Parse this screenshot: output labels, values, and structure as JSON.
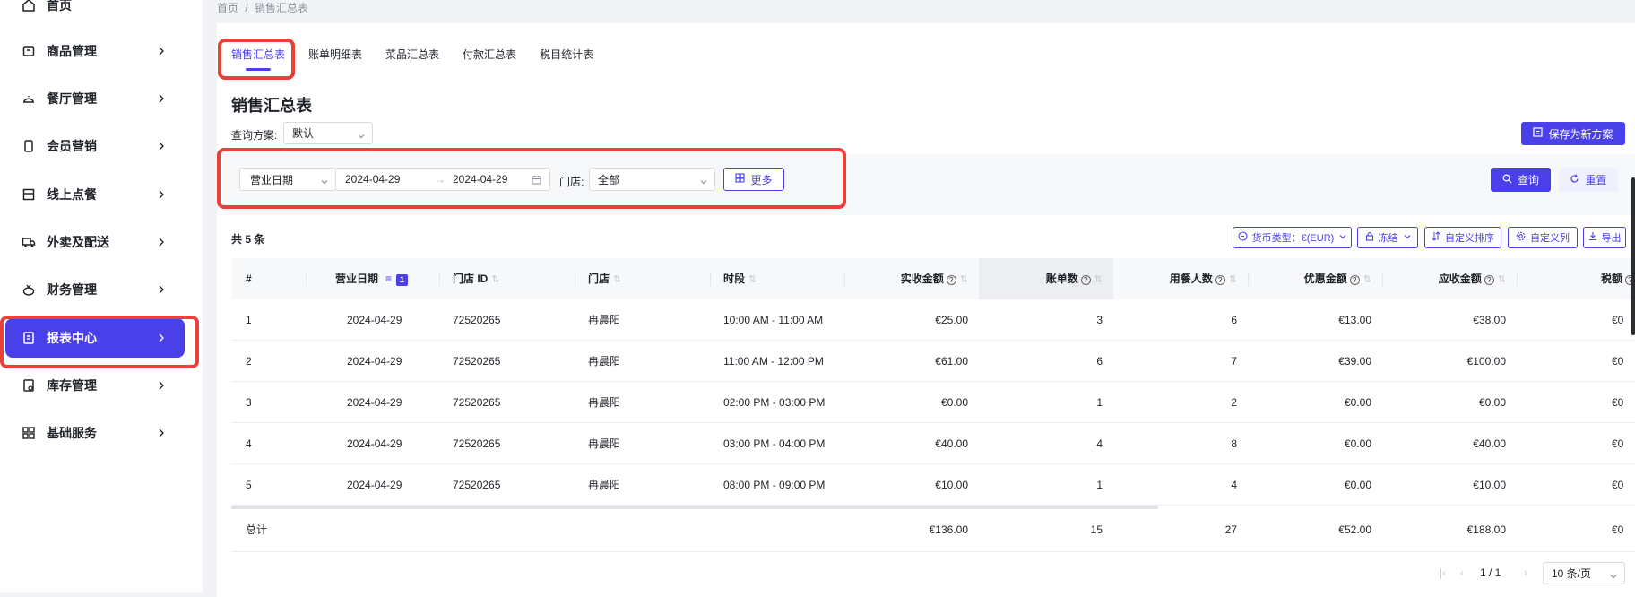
{
  "sidebar": {
    "items": [
      {
        "label": "首页",
        "icon": "home-icon"
      },
      {
        "label": "商品管理",
        "icon": "box-icon"
      },
      {
        "label": "餐厅管理",
        "icon": "restaurant-icon"
      },
      {
        "label": "会员营销",
        "icon": "phone-icon"
      },
      {
        "label": "线上点餐",
        "icon": "store-icon"
      },
      {
        "label": "外卖及配送",
        "icon": "truck-icon"
      },
      {
        "label": "财务管理",
        "icon": "finance-icon"
      },
      {
        "label": "报表中心",
        "icon": "report-icon",
        "active": true
      },
      {
        "label": "库存管理",
        "icon": "inventory-icon"
      },
      {
        "label": "基础服务",
        "icon": "grid-icon"
      }
    ]
  },
  "breadcrumb": {
    "home": "首页",
    "sep": "/",
    "current": "销售汇总表"
  },
  "tabs": [
    "销售汇总表",
    "账单明细表",
    "菜品汇总表",
    "付款汇总表",
    "税目统计表"
  ],
  "page": {
    "title": "销售汇总表",
    "scheme_label": "查询方案:",
    "scheme_value": "默认",
    "save_button": "保存为新方案"
  },
  "filters": {
    "date_type": "营业日期",
    "start_date": "2024-04-29",
    "arrow": "→",
    "end_date": "2024-04-29",
    "store_label": "门店:",
    "store_value": "全部",
    "more_button": "更多",
    "query_button": "查询",
    "reset_button": "重置"
  },
  "toolbar": {
    "count": "共 5 条",
    "currency": "货币类型：€(EUR)",
    "freeze": "冻结",
    "custom_sort": "自定义排序",
    "custom_cols": "自定义列",
    "export": "导出"
  },
  "table": {
    "headers": {
      "idx": "#",
      "date": "营业日期",
      "date_badge": "1",
      "store_id": "门店 ID",
      "store": "门店",
      "period": "时段",
      "paid": "实收金额",
      "bills": "账单数",
      "diners": "用餐人数",
      "discount": "优惠金额",
      "receivable": "应收金额",
      "tax": "税额"
    },
    "rows": [
      {
        "idx": "1",
        "date": "2024-04-29",
        "store_id": "72520265",
        "store": "冉晨阳",
        "period": "10:00 AM - 11:00 AM",
        "paid": "€25.00",
        "bills": "3",
        "diners": "6",
        "discount": "€13.00",
        "receivable": "€38.00",
        "tax": "€0"
      },
      {
        "idx": "2",
        "date": "2024-04-29",
        "store_id": "72520265",
        "store": "冉晨阳",
        "period": "11:00 AM - 12:00 PM",
        "paid": "€61.00",
        "bills": "6",
        "diners": "7",
        "discount": "€39.00",
        "receivable": "€100.00",
        "tax": "€0"
      },
      {
        "idx": "3",
        "date": "2024-04-29",
        "store_id": "72520265",
        "store": "冉晨阳",
        "period": "02:00 PM - 03:00 PM",
        "paid": "€0.00",
        "bills": "1",
        "diners": "2",
        "discount": "€0.00",
        "receivable": "€0.00",
        "tax": "€0"
      },
      {
        "idx": "4",
        "date": "2024-04-29",
        "store_id": "72520265",
        "store": "冉晨阳",
        "period": "03:00 PM - 04:00 PM",
        "paid": "€40.00",
        "bills": "4",
        "diners": "8",
        "discount": "€0.00",
        "receivable": "€40.00",
        "tax": "€0"
      },
      {
        "idx": "5",
        "date": "2024-04-29",
        "store_id": "72520265",
        "store": "冉晨阳",
        "period": "08:00 PM - 09:00 PM",
        "paid": "€10.00",
        "bills": "1",
        "diners": "4",
        "discount": "€0.00",
        "receivable": "€10.00",
        "tax": "€0"
      }
    ],
    "total": {
      "label": "总计",
      "paid": "€136.00",
      "bills": "15",
      "diners": "27",
      "discount": "€52.00",
      "receivable": "€188.00",
      "tax": "€0"
    }
  },
  "pagination": {
    "page": "1 / 1",
    "page_size": "10 条/页"
  },
  "colors": {
    "accent": "#4a40ea",
    "highlight": "#e8413a"
  }
}
